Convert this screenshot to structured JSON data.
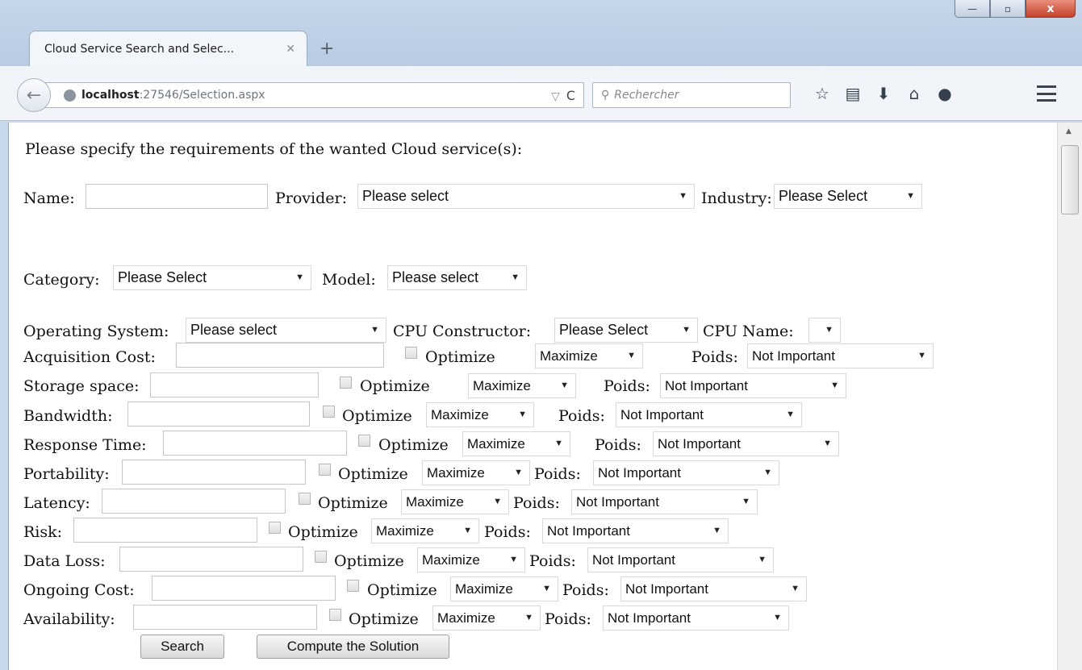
{
  "window": {
    "minimize_label": "—",
    "restore_label": "▫",
    "close_label": "x"
  },
  "tab": {
    "title": "Cloud Service Search and Selec...",
    "close_label": "✕",
    "new_tab_label": "+"
  },
  "navbar": {
    "back_icon": "arrow-left-icon",
    "url_host": "localhost",
    "url_rest": ":27546/Selection.aspx",
    "url_dropdown": "▽",
    "reload": "C",
    "search_placeholder": "Rechercher",
    "icons": [
      "star-icon",
      "reading-list-icon",
      "download-icon",
      "home-icon",
      "chat-icon",
      "menu-icon"
    ],
    "icon_glyphs": [
      "☆",
      "▤",
      "⬇",
      "⌂",
      "●"
    ]
  },
  "form": {
    "intro": "Please specify the requirements of the wanted Cloud service(s):",
    "name_label": "Name:",
    "provider_label": "Provider:",
    "provider_value": "Please select",
    "industry_label": "Industry:",
    "industry_value": "Please Select",
    "category_label": "Category:",
    "category_value": "Please Select",
    "model_label": "Model:",
    "model_value": "Please select",
    "os_label": "Operating System:",
    "os_value": "Please select",
    "cpu_constructor_label": "CPU Constructor:",
    "cpu_constructor_value": "Please Select",
    "cpu_name_label": "CPU Name:",
    "cpu_name_value": "",
    "optimize_label": "Optimize",
    "poids_label": "Poids:",
    "criteria": [
      {
        "label": "Acquisition Cost:",
        "direction": "Maximize",
        "weight": "Not Important"
      },
      {
        "label": "Storage space:",
        "direction": "Maximize",
        "weight": "Not Important"
      },
      {
        "label": "Bandwidth:",
        "direction": "Maximize",
        "weight": "Not Important"
      },
      {
        "label": "Response Time:",
        "direction": "Maximize",
        "weight": "Not Important"
      },
      {
        "label": "Portability:",
        "direction": "Maximize",
        "weight": "Not Important"
      },
      {
        "label": "Latency:",
        "direction": "Maximize",
        "weight": "Not Important"
      },
      {
        "label": "Risk:",
        "direction": "Maximize",
        "weight": "Not Important"
      },
      {
        "label": "Data Loss:",
        "direction": "Maximize",
        "weight": "Not Important"
      },
      {
        "label": "Ongoing Cost:",
        "direction": "Maximize",
        "weight": "Not Important"
      },
      {
        "label": "Availability:",
        "direction": "Maximize",
        "weight": "Not Important"
      }
    ],
    "search_button": "Search",
    "compute_button": "Compute the Solution"
  }
}
